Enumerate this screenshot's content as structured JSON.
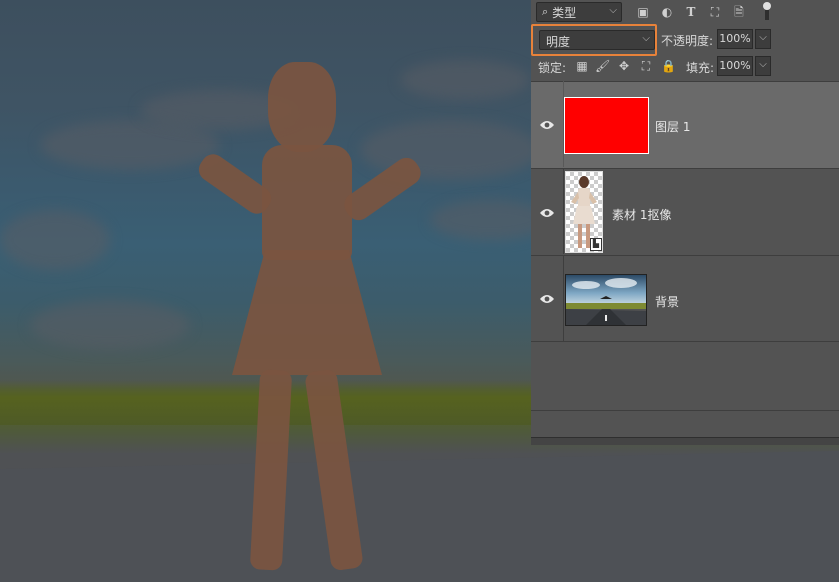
{
  "colors": {
    "panel_bg": "#535353",
    "selected_layer_bg": "#6a6a6a",
    "highlight_border": "#e8823a",
    "layer1_fill": "#ff0000"
  },
  "filter": {
    "kind_label": "类型",
    "icons": [
      "pixel-filter-icon",
      "adjustment-filter-icon",
      "type-filter-icon",
      "shape-filter-icon",
      "smart-object-filter-icon",
      "filter-toggle-icon"
    ]
  },
  "blend": {
    "mode": "明度",
    "opacity_label": "不透明度:",
    "opacity_value": "100%"
  },
  "lock": {
    "label": "锁定:",
    "icons": [
      "lock-transparent-pixels-icon",
      "lock-image-pixels-icon",
      "lock-position-icon",
      "lock-artboard-icon",
      "lock-all-icon"
    ],
    "fill_label": "填充:",
    "fill_value": "100%"
  },
  "layers": [
    {
      "name": "图层 1",
      "selected": true,
      "visible": true,
      "type": "solid-red"
    },
    {
      "name": "素材 1抠像",
      "selected": false,
      "visible": true,
      "type": "cutout-person"
    },
    {
      "name": "背景",
      "selected": false,
      "visible": true,
      "type": "background-photo"
    }
  ]
}
